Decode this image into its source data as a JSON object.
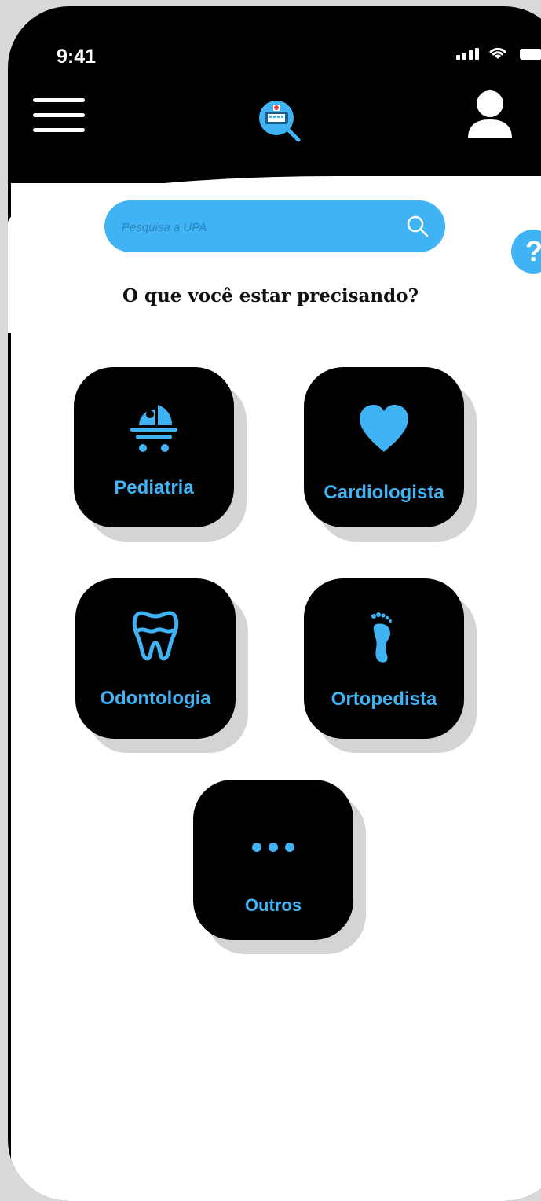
{
  "status_bar": {
    "time": "9:41"
  },
  "search": {
    "placeholder": "Pesquisa a UPA"
  },
  "help": {
    "label": "?"
  },
  "question": "O que você estar precisando?",
  "categories": [
    {
      "label": "Pediatria",
      "icon": "baby-stroller-icon"
    },
    {
      "label": "Cardiologista",
      "icon": "heart-icon"
    },
    {
      "label": "Odontologia",
      "icon": "tooth-icon"
    },
    {
      "label": "Ortopedista",
      "icon": "footprint-icon"
    },
    {
      "label": "Outros",
      "icon": "more-dots-icon"
    }
  ],
  "colors": {
    "accent": "#40b3f5",
    "background": "#000000",
    "screen": "#ffffff"
  }
}
